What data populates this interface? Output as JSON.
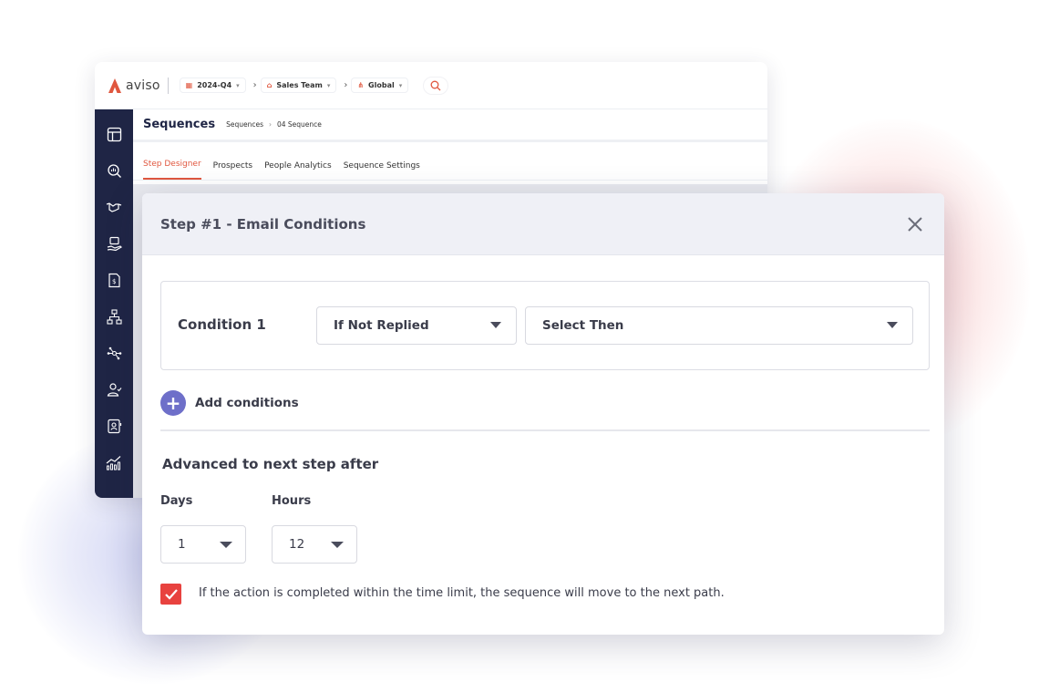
{
  "app": {
    "logo_text": "aviso",
    "filters": [
      {
        "label": "2024-Q4",
        "icon": "calendar-icon"
      },
      {
        "label": "Sales Team",
        "icon": "building-icon"
      },
      {
        "label": "Global",
        "icon": "hierarchy-icon"
      }
    ],
    "page_title": "Sequences",
    "breadcrumb": [
      "Sequences",
      "04 Sequence"
    ],
    "tabs": [
      "Step Designer",
      "Prospects",
      "People Analytics",
      "Sequence Settings"
    ],
    "active_tab": "Step Designer",
    "sidebar_icons": [
      "layout-icon",
      "analytics-search-icon",
      "handshake-icon",
      "deal-icon",
      "invoice-icon",
      "org-chart-icon",
      "network-icon",
      "user-check-icon",
      "contact-card-icon",
      "growth-chart-icon"
    ]
  },
  "modal": {
    "title": "Step #1 - Email Conditions",
    "condition_label": "Condition 1",
    "condition_select": "If Not Replied",
    "then_select": "Select Then",
    "add_conditions": "Add conditions",
    "advanced_title": "Advanced to next step after",
    "days_label": "Days",
    "days_value": "1",
    "hours_label": "Hours",
    "hours_value": "12",
    "checkbox_checked": true,
    "checkbox_text": "If the action is completed within the time limit, the sequence will move to the next path."
  },
  "colors": {
    "accent": "#e0573f",
    "sidebar": "#1f2545",
    "add_button": "#6e6fc9",
    "checkbox": "#e8423f"
  }
}
